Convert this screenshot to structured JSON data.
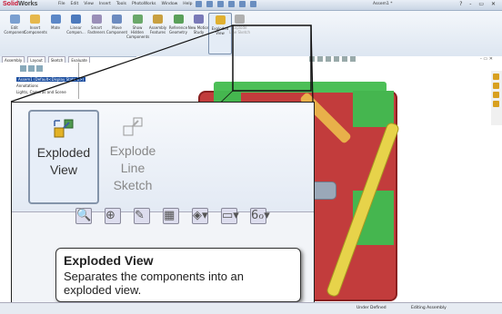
{
  "app": {
    "logo_a": "Solid",
    "logo_b": "Works",
    "window_title": "Assem1 *",
    "window_controls": "? - ▭ ✕"
  },
  "menu": [
    "File",
    "Edit",
    "View",
    "Insert",
    "Tools",
    "PhotoWorks",
    "Window",
    "Help"
  ],
  "ribbon": [
    {
      "label": "Edit Component",
      "color": "#7a9fd0"
    },
    {
      "label": "Insert Components",
      "color": "#e6b84c"
    },
    {
      "label": "Mate",
      "color": "#5b87c7"
    },
    {
      "label": "Linear Compon...",
      "color": "#4c7abd"
    },
    {
      "label": "Smart Fasteners",
      "color": "#9a8fb8"
    },
    {
      "label": "Move Component",
      "color": "#6c8bc0"
    },
    {
      "label": "Show Hidden Components",
      "color": "#6aa86a"
    },
    {
      "label": "Assembly Features",
      "color": "#c9a040"
    },
    {
      "label": "Reference Geometry",
      "color": "#5aa05a"
    },
    {
      "label": "New Motion Study",
      "color": "#7a7ab8"
    },
    {
      "label": "Exploded View",
      "color": "#e0b030"
    },
    {
      "label": "Explode Line Sketch",
      "color": "#b0b0b0"
    }
  ],
  "small_tooltip": {
    "title": "Exploded View",
    "desc": "Separates the components into an exploded view."
  },
  "fm_tabs": [
    "Assembly",
    "Layout",
    "Sketch",
    "Evaluate"
  ],
  "tree": {
    "root": "Assem1 (Default<Display State-1>)",
    "items": [
      "Annotations",
      "Lights, Cameras and Scene"
    ]
  },
  "zoom": {
    "cut_label": "h",
    "btn_active": [
      "Exploded",
      "View"
    ],
    "btn_dim": [
      "Explode",
      "Line",
      "Sketch"
    ],
    "toolbar": [
      "🔍",
      "⊕",
      "✎",
      "▦",
      "◈▾",
      "▭▾",
      "6ℴ▾"
    ]
  },
  "tooltip": {
    "title": "Exploded View",
    "desc": "Separates the components into an exploded view."
  },
  "status": {
    "left": "Under Defined",
    "right": "Editing Assembly"
  }
}
